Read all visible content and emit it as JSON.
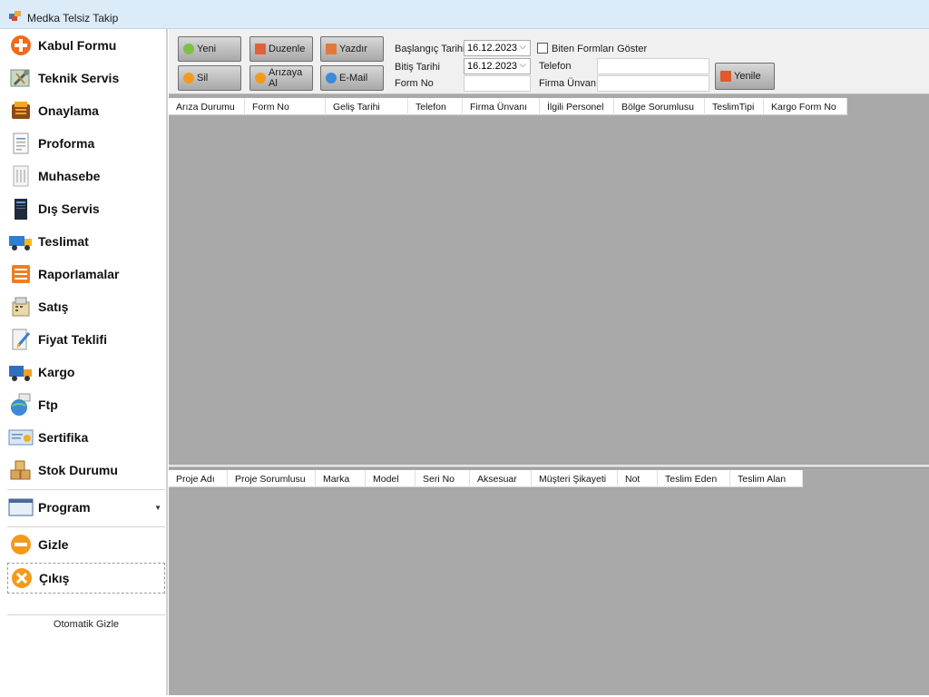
{
  "window": {
    "title": "Medka Telsiz Takip"
  },
  "sidebar": {
    "items": [
      {
        "label": "Kabul Formu",
        "icon": "plus-circle-icon"
      },
      {
        "label": "Teknik Servis",
        "icon": "tools-icon"
      },
      {
        "label": "Onaylama",
        "icon": "approval-icon"
      },
      {
        "label": "Proforma",
        "icon": "document-icon"
      },
      {
        "label": "Muhasebe",
        "icon": "ledger-icon"
      },
      {
        "label": "Dış Servis",
        "icon": "server-icon"
      },
      {
        "label": "Teslimat",
        "icon": "truck-icon"
      },
      {
        "label": "Raporlamalar",
        "icon": "report-icon"
      },
      {
        "label": "Satış",
        "icon": "sales-icon"
      },
      {
        "label": "Fiyat Teklifi",
        "icon": "quote-icon"
      },
      {
        "label": "Kargo",
        "icon": "cargo-truck-icon"
      },
      {
        "label": "Ftp",
        "icon": "globe-icon"
      },
      {
        "label": "Sertifika",
        "icon": "certificate-icon"
      },
      {
        "label": "Stok Durumu",
        "icon": "boxes-icon"
      }
    ],
    "program": {
      "label": "Program",
      "icon": "program-window-icon"
    },
    "hide": {
      "label": "Gizle",
      "icon": "minus-circle-icon"
    },
    "exit": {
      "label": "Çıkış",
      "icon": "close-circle-icon"
    },
    "auto_hide": "Otomatik Gizle"
  },
  "toolbar": {
    "buttons": {
      "new": "Yeni",
      "edit": "Duzenle",
      "print": "Yazdır",
      "delete": "Sil",
      "fault": "Arızaya Al",
      "email": "E-Mail",
      "refresh": "Yenile"
    },
    "filters": {
      "start_date_label": "Başlangıç Tarihi",
      "start_date_value": "16.12.2023",
      "end_date_label": "Bitiş Tarihi",
      "end_date_value": "16.12.2023",
      "form_no_label": "Form No",
      "form_no_value": "",
      "show_finished_label": "Biten Formları Göster",
      "show_finished_checked": false,
      "phone_label": "Telefon",
      "phone_value": "",
      "company_label": "Firma Ünvanı",
      "company_value": ""
    }
  },
  "forms_grid": {
    "columns": [
      "Arıza Durumu",
      "Form No",
      "Geliş Tarihi",
      "Telefon",
      "Firma Ünvanı",
      "İlgili Personel",
      "Bölge Sorumlusu",
      "TeslimTipi",
      "Kargo Form No"
    ],
    "rows": []
  },
  "details_grid": {
    "columns": [
      "Proje Adı",
      "Proje Sorumlusu",
      "Marka",
      "Model",
      "Seri No",
      "Aksesuar",
      "Müşteri Şikayeti",
      "Not",
      "Teslim Eden",
      "Teslim Alan"
    ],
    "rows": []
  }
}
